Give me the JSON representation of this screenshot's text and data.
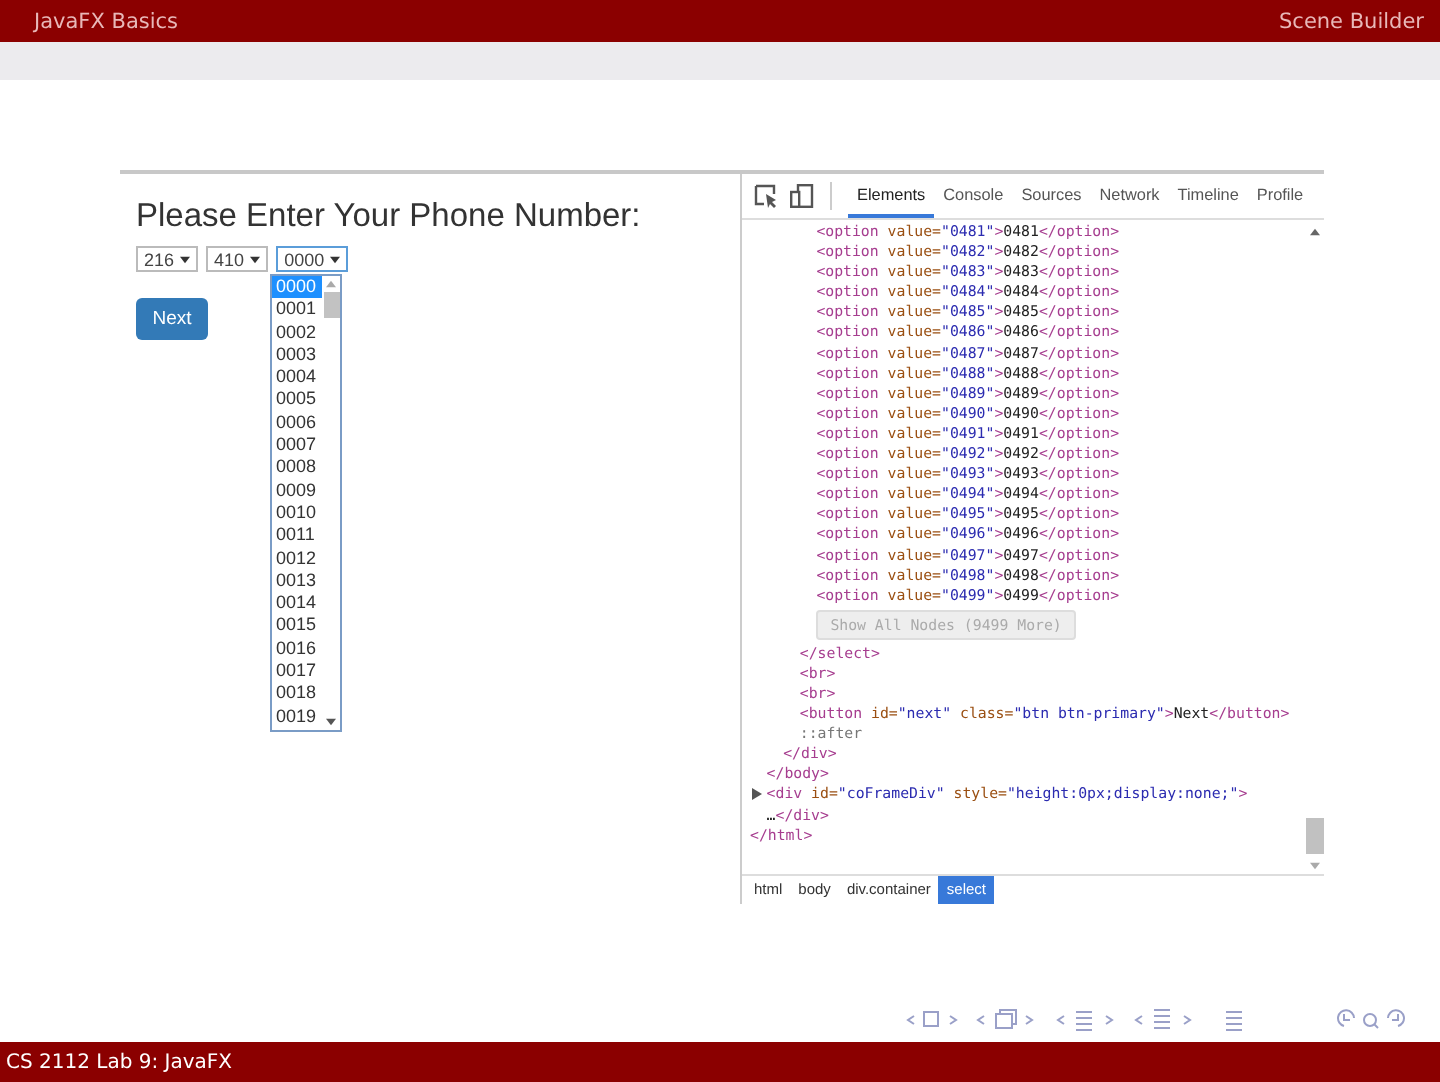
{
  "slide_header": {
    "left": "JavaFX Basics",
    "right": "Scene Builder"
  },
  "page": {
    "heading": "Please Enter Your Phone Number:",
    "selects": [
      {
        "value": "216",
        "open": false
      },
      {
        "value": "410",
        "open": false
      },
      {
        "value": "0000",
        "open": true
      }
    ],
    "dropdown_options": [
      {
        "label": "0000",
        "selected": true
      },
      {
        "label": "0001",
        "selected": false
      },
      {
        "label": "0002",
        "selected": false
      },
      {
        "label": "0003",
        "selected": false
      },
      {
        "label": "0004",
        "selected": false
      },
      {
        "label": "0005",
        "selected": false
      },
      {
        "label": "0006",
        "selected": false
      },
      {
        "label": "0007",
        "selected": false
      },
      {
        "label": "0008",
        "selected": false
      },
      {
        "label": "0009",
        "selected": false
      },
      {
        "label": "0010",
        "selected": false
      },
      {
        "label": "0011",
        "selected": false
      },
      {
        "label": "0012",
        "selected": false
      },
      {
        "label": "0013",
        "selected": false
      },
      {
        "label": "0014",
        "selected": false
      },
      {
        "label": "0015",
        "selected": false
      },
      {
        "label": "0016",
        "selected": false
      },
      {
        "label": "0017",
        "selected": false
      },
      {
        "label": "0018",
        "selected": false
      },
      {
        "label": "0019",
        "selected": false
      }
    ],
    "button": "Next"
  },
  "devtools": {
    "tabs": [
      {
        "label": "Elements",
        "selected": true
      },
      {
        "label": "Console",
        "selected": false
      },
      {
        "label": "Sources",
        "selected": false
      },
      {
        "label": "Network",
        "selected": false
      },
      {
        "label": "Timeline",
        "selected": false
      },
      {
        "label": "Profile",
        "selected": false
      }
    ],
    "tree": [
      {
        "children": [
          {
            "children": [
              {
                "children": [
                  {
                    "children": [
                      {
                        "line": [
                          {
                            "text": "<option",
                            "kind": "tag"
                          },
                          {
                            "text": " value=",
                            "kind": "attr"
                          },
                          {
                            "text": "\"0481\"",
                            "kind": "value"
                          },
                          {
                            "text": ">",
                            "kind": "tag"
                          },
                          {
                            "text": "0481",
                            "kind": "plain"
                          },
                          {
                            "text": "</option>",
                            "kind": "tag"
                          }
                        ]
                      },
                      {
                        "line": [
                          {
                            "text": "<option",
                            "kind": "tag"
                          },
                          {
                            "text": " value=",
                            "kind": "attr"
                          },
                          {
                            "text": "\"0482\"",
                            "kind": "value"
                          },
                          {
                            "text": ">",
                            "kind": "tag"
                          },
                          {
                            "text": "0482",
                            "kind": "plain"
                          },
                          {
                            "text": "</option>",
                            "kind": "tag"
                          }
                        ]
                      },
                      {
                        "line": [
                          {
                            "text": "<option",
                            "kind": "tag"
                          },
                          {
                            "text": " value=",
                            "kind": "attr"
                          },
                          {
                            "text": "\"0483\"",
                            "kind": "value"
                          },
                          {
                            "text": ">",
                            "kind": "tag"
                          },
                          {
                            "text": "0483",
                            "kind": "plain"
                          },
                          {
                            "text": "</option>",
                            "kind": "tag"
                          }
                        ]
                      },
                      {
                        "line": [
                          {
                            "text": "<option",
                            "kind": "tag"
                          },
                          {
                            "text": " value=",
                            "kind": "attr"
                          },
                          {
                            "text": "\"0484\"",
                            "kind": "value"
                          },
                          {
                            "text": ">",
                            "kind": "tag"
                          },
                          {
                            "text": "0484",
                            "kind": "plain"
                          },
                          {
                            "text": "</option>",
                            "kind": "tag"
                          }
                        ]
                      },
                      {
                        "line": [
                          {
                            "text": "<option",
                            "kind": "tag"
                          },
                          {
                            "text": " value=",
                            "kind": "attr"
                          },
                          {
                            "text": "\"0485\"",
                            "kind": "value"
                          },
                          {
                            "text": ">",
                            "kind": "tag"
                          },
                          {
                            "text": "0485",
                            "kind": "plain"
                          },
                          {
                            "text": "</option>",
                            "kind": "tag"
                          }
                        ]
                      },
                      {
                        "line": [
                          {
                            "text": "<option",
                            "kind": "tag"
                          },
                          {
                            "text": " value=",
                            "kind": "attr"
                          },
                          {
                            "text": "\"0486\"",
                            "kind": "value"
                          },
                          {
                            "text": ">",
                            "kind": "tag"
                          },
                          {
                            "text": "0486",
                            "kind": "plain"
                          },
                          {
                            "text": "</option>",
                            "kind": "tag"
                          }
                        ]
                      },
                      {
                        "line": [
                          {
                            "text": "<option",
                            "kind": "tag"
                          },
                          {
                            "text": " value=",
                            "kind": "attr"
                          },
                          {
                            "text": "\"0487\"",
                            "kind": "value"
                          },
                          {
                            "text": ">",
                            "kind": "tag"
                          },
                          {
                            "text": "0487",
                            "kind": "plain"
                          },
                          {
                            "text": "</option>",
                            "kind": "tag"
                          }
                        ]
                      },
                      {
                        "line": [
                          {
                            "text": "<option",
                            "kind": "tag"
                          },
                          {
                            "text": " value=",
                            "kind": "attr"
                          },
                          {
                            "text": "\"0488\"",
                            "kind": "value"
                          },
                          {
                            "text": ">",
                            "kind": "tag"
                          },
                          {
                            "text": "0488",
                            "kind": "plain"
                          },
                          {
                            "text": "</option>",
                            "kind": "tag"
                          }
                        ]
                      },
                      {
                        "line": [
                          {
                            "text": "<option",
                            "kind": "tag"
                          },
                          {
                            "text": " value=",
                            "kind": "attr"
                          },
                          {
                            "text": "\"0489\"",
                            "kind": "value"
                          },
                          {
                            "text": ">",
                            "kind": "tag"
                          },
                          {
                            "text": "0489",
                            "kind": "plain"
                          },
                          {
                            "text": "</option>",
                            "kind": "tag"
                          }
                        ]
                      },
                      {
                        "line": [
                          {
                            "text": "<option",
                            "kind": "tag"
                          },
                          {
                            "text": " value=",
                            "kind": "attr"
                          },
                          {
                            "text": "\"0490\"",
                            "kind": "value"
                          },
                          {
                            "text": ">",
                            "kind": "tag"
                          },
                          {
                            "text": "0490",
                            "kind": "plain"
                          },
                          {
                            "text": "</option>",
                            "kind": "tag"
                          }
                        ]
                      },
                      {
                        "line": [
                          {
                            "text": "<option",
                            "kind": "tag"
                          },
                          {
                            "text": " value=",
                            "kind": "attr"
                          },
                          {
                            "text": "\"0491\"",
                            "kind": "value"
                          },
                          {
                            "text": ">",
                            "kind": "tag"
                          },
                          {
                            "text": "0491",
                            "kind": "plain"
                          },
                          {
                            "text": "</option>",
                            "kind": "tag"
                          }
                        ]
                      },
                      {
                        "line": [
                          {
                            "text": "<option",
                            "kind": "tag"
                          },
                          {
                            "text": " value=",
                            "kind": "attr"
                          },
                          {
                            "text": "\"0492\"",
                            "kind": "value"
                          },
                          {
                            "text": ">",
                            "kind": "tag"
                          },
                          {
                            "text": "0492",
                            "kind": "plain"
                          },
                          {
                            "text": "</option>",
                            "kind": "tag"
                          }
                        ]
                      },
                      {
                        "line": [
                          {
                            "text": "<option",
                            "kind": "tag"
                          },
                          {
                            "text": " value=",
                            "kind": "attr"
                          },
                          {
                            "text": "\"0493\"",
                            "kind": "value"
                          },
                          {
                            "text": ">",
                            "kind": "tag"
                          },
                          {
                            "text": "0493",
                            "kind": "plain"
                          },
                          {
                            "text": "</option>",
                            "kind": "tag"
                          }
                        ]
                      },
                      {
                        "line": [
                          {
                            "text": "<option",
                            "kind": "tag"
                          },
                          {
                            "text": " value=",
                            "kind": "attr"
                          },
                          {
                            "text": "\"0494\"",
                            "kind": "value"
                          },
                          {
                            "text": ">",
                            "kind": "tag"
                          },
                          {
                            "text": "0494",
                            "kind": "plain"
                          },
                          {
                            "text": "</option>",
                            "kind": "tag"
                          }
                        ]
                      },
                      {
                        "line": [
                          {
                            "text": "<option",
                            "kind": "tag"
                          },
                          {
                            "text": " value=",
                            "kind": "attr"
                          },
                          {
                            "text": "\"0495\"",
                            "kind": "value"
                          },
                          {
                            "text": ">",
                            "kind": "tag"
                          },
                          {
                            "text": "0495",
                            "kind": "plain"
                          },
                          {
                            "text": "</option>",
                            "kind": "tag"
                          }
                        ]
                      },
                      {
                        "line": [
                          {
                            "text": "<option",
                            "kind": "tag"
                          },
                          {
                            "text": " value=",
                            "kind": "attr"
                          },
                          {
                            "text": "\"0496\"",
                            "kind": "value"
                          },
                          {
                            "text": ">",
                            "kind": "tag"
                          },
                          {
                            "text": "0496",
                            "kind": "plain"
                          },
                          {
                            "text": "</option>",
                            "kind": "tag"
                          }
                        ]
                      },
                      {
                        "line": [
                          {
                            "text": "<option",
                            "kind": "tag"
                          },
                          {
                            "text": " value=",
                            "kind": "attr"
                          },
                          {
                            "text": "\"0497\"",
                            "kind": "value"
                          },
                          {
                            "text": ">",
                            "kind": "tag"
                          },
                          {
                            "text": "0497",
                            "kind": "plain"
                          },
                          {
                            "text": "</option>",
                            "kind": "tag"
                          }
                        ]
                      },
                      {
                        "line": [
                          {
                            "text": "<option",
                            "kind": "tag"
                          },
                          {
                            "text": " value=",
                            "kind": "attr"
                          },
                          {
                            "text": "\"0498\"",
                            "kind": "value"
                          },
                          {
                            "text": ">",
                            "kind": "tag"
                          },
                          {
                            "text": "0498",
                            "kind": "plain"
                          },
                          {
                            "text": "</option>",
                            "kind": "tag"
                          }
                        ]
                      },
                      {
                        "line": [
                          {
                            "text": "<option",
                            "kind": "tag"
                          },
                          {
                            "text": " value=",
                            "kind": "attr"
                          },
                          {
                            "text": "\"0499\"",
                            "kind": "value"
                          },
                          {
                            "text": ">",
                            "kind": "tag"
                          },
                          {
                            "text": "0499",
                            "kind": "plain"
                          },
                          {
                            "text": "</option>",
                            "kind": "tag"
                          }
                        ]
                      },
                      {
                        "kind": "button",
                        "label": "Show All Nodes (9499 More)"
                      }
                    ],
                    "close": [
                      {
                        "text": "</select>",
                        "kind": "tag"
                      }
                    ]
                  },
                  {
                    "line": [
                      {
                        "text": "<br>",
                        "kind": "tag"
                      }
                    ]
                  },
                  {
                    "line": [
                      {
                        "text": "<br>",
                        "kind": "tag"
                      }
                    ]
                  },
                  {
                    "line": [
                      {
                        "text": "<button",
                        "kind": "tag"
                      },
                      {
                        "text": " id=",
                        "kind": "attr"
                      },
                      {
                        "text": "\"next\"",
                        "kind": "value"
                      },
                      {
                        "text": " class=",
                        "kind": "attr"
                      },
                      {
                        "text": "\"btn btn-primary\"",
                        "kind": "value"
                      },
                      {
                        "text": ">",
                        "kind": "tag"
                      },
                      {
                        "text": "Next",
                        "kind": "plain"
                      },
                      {
                        "text": "</button>",
                        "kind": "tag"
                      }
                    ]
                  },
                  {
                    "line": [
                      {
                        "text": "::after",
                        "kind": "pseudo"
                      }
                    ]
                  }
                ],
                "close": [
                  {
                    "text": "</div>",
                    "kind": "tag"
                  }
                ]
              }
            ],
            "close": [
              {
                "text": "</body>",
                "kind": "tag"
              }
            ]
          },
          {
            "collapsed": true,
            "line": [
              {
                "text": "<div",
                "kind": "tag"
              },
              {
                "text": " id=",
                "kind": "attr"
              },
              {
                "text": "\"coFrameDiv\"",
                "kind": "value"
              },
              {
                "text": " style=",
                "kind": "attr"
              },
              {
                "text": "\"height:0px;display:none;\"",
                "kind": "value"
              },
              {
                "text": ">",
                "kind": "tag"
              }
            ],
            "close": [
              {
                "text": "…",
                "kind": "plain"
              },
              {
                "text": "</div>",
                "kind": "tag"
              }
            ]
          }
        ],
        "close": [
          {
            "text": "</html>",
            "kind": "tag"
          }
        ]
      }
    ],
    "breadcrumbs": [
      {
        "label": "html",
        "selected": false
      },
      {
        "label": "body",
        "selected": false
      },
      {
        "label": "div.container",
        "selected": false
      },
      {
        "label": "select",
        "selected": true
      }
    ]
  },
  "slide_footer": "CS 2112 Lab 9: JavaFX"
}
